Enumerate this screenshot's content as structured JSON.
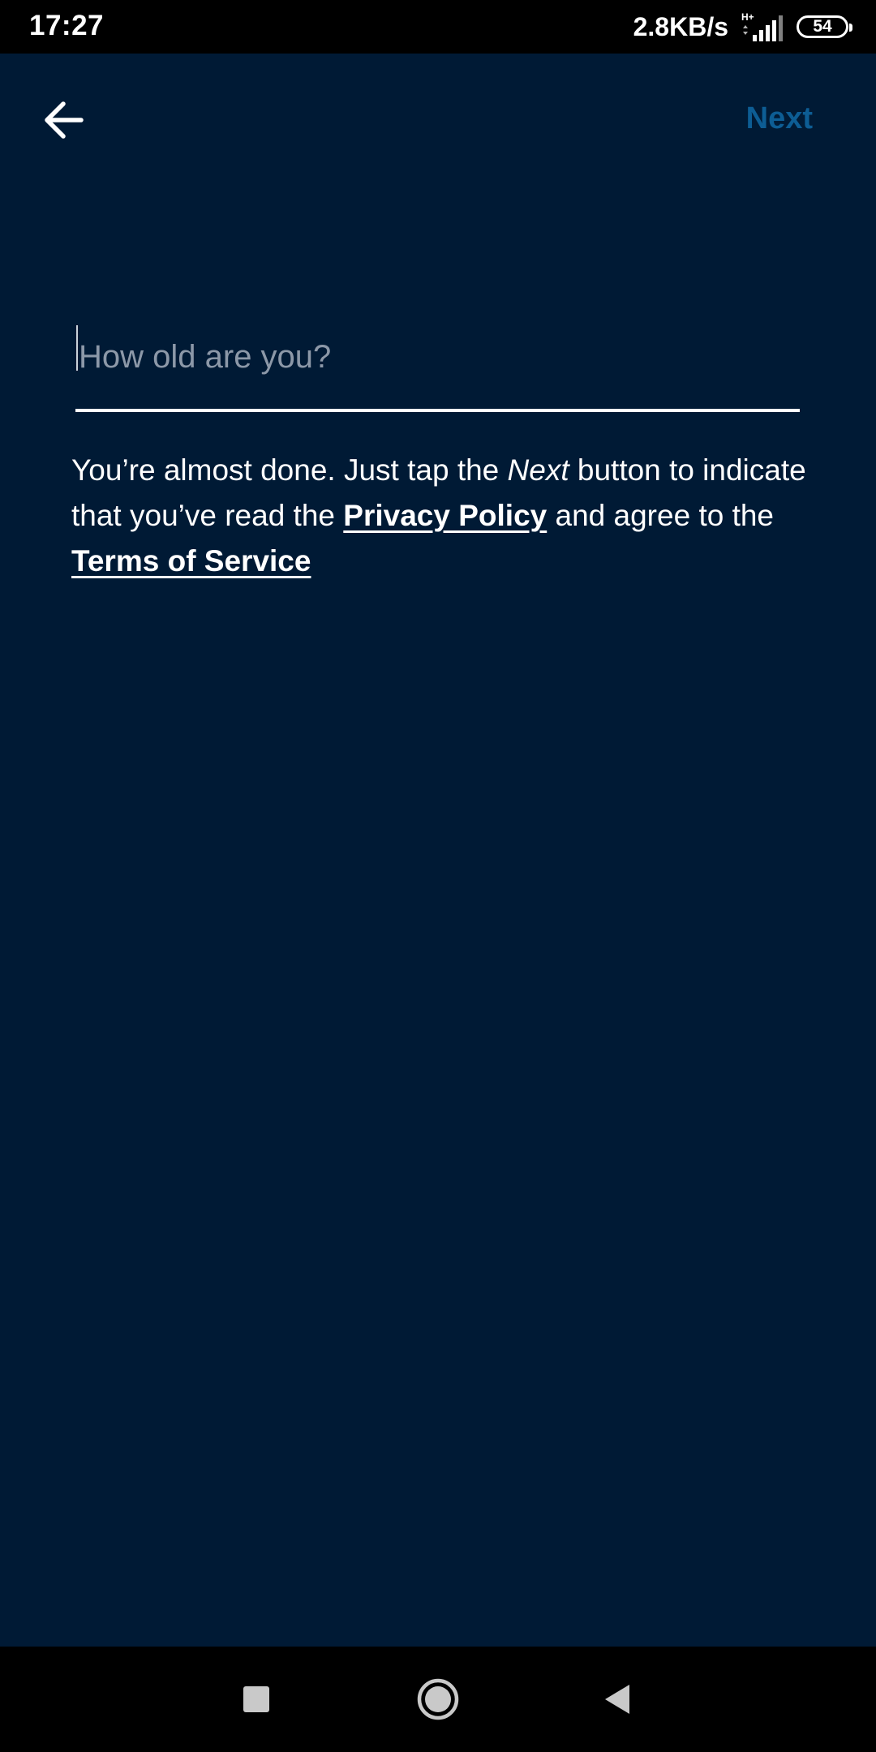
{
  "status_bar": {
    "time": "17:27",
    "net_speed": "2.8KB/s",
    "network_type": "H+",
    "battery_level": "54",
    "icons": [
      "signal-icon",
      "battery-icon"
    ]
  },
  "header": {
    "back_icon": "arrow-left-icon",
    "next_label": "Next",
    "next_color": "#0d5d94"
  },
  "age_input": {
    "placeholder": "How old are you?",
    "value": ""
  },
  "consent": {
    "part1": "You’re almost done. Just tap the ",
    "next_word": "Next",
    "part2": " button to indicate that you’ve read the ",
    "privacy_link": "Privacy Policy",
    "part3": " and agree to the ",
    "terms_link": "Terms of Service"
  },
  "nav_bar": {
    "icons": [
      "recents-square-icon",
      "home-circle-icon",
      "back-triangle-icon"
    ]
  },
  "colors": {
    "background": "#001a35",
    "accent": "#0d5d94",
    "text": "#ffffff",
    "placeholder": "#8c98a8"
  }
}
